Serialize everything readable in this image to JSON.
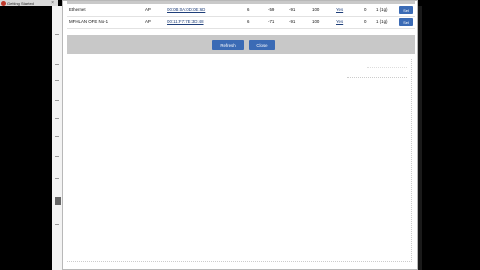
{
  "tab": {
    "title": "Getting Started",
    "close_glyph": "×"
  },
  "table": {
    "rows": [
      {
        "name": "Ethernet",
        "type": "AP",
        "bssid": "00:0B:0A:0D:0E:6D",
        "channel": "6",
        "signal": "-59",
        "noise": "-91",
        "rate": "100",
        "encryption": "Yes",
        "n": "0",
        "cost": "1 (1g)",
        "select": "Sel"
      },
      {
        "name": "MFHLAN OFE No-1",
        "type": "AP",
        "bssid": "00:11:F7:7E:3D:48",
        "channel": "6",
        "signal": "-71",
        "noise": "-91",
        "rate": "100",
        "encryption": "Yes",
        "n": "0",
        "cost": "1 (1g)",
        "select": "Sel"
      }
    ]
  },
  "buttons": {
    "refresh": "Refresh",
    "close": "Close"
  }
}
